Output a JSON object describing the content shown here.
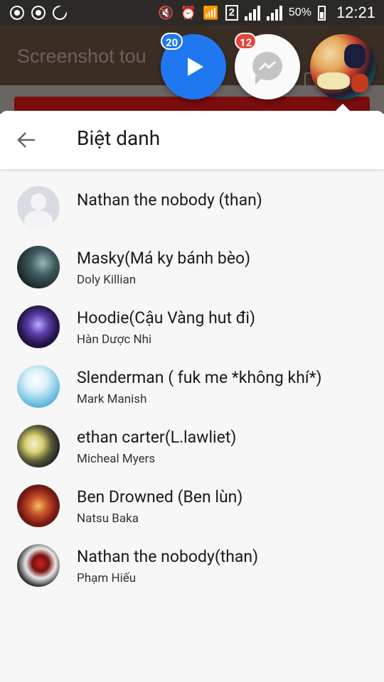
{
  "status_bar": {
    "sim_slot": "2",
    "battery": "50%",
    "time": "12:21"
  },
  "background_app": {
    "title": "Screenshot tou"
  },
  "chat_heads": {
    "play_badge": "20",
    "messenger_badge": "12"
  },
  "panel": {
    "title": "Biệt danh",
    "members": [
      {
        "nickname": "Nathan the nobody (than)",
        "name": ""
      },
      {
        "nickname": "Masky(Má ky bánh bèo)",
        "name": "Doly Killian"
      },
      {
        "nickname": "Hoodie(Cậu Vàng hut đi)",
        "name": "Hàn Dược Nhi"
      },
      {
        "nickname": "Slenderman ( fuk me *không khí*)",
        "name": "Mark Manish"
      },
      {
        "nickname": "ethan carter(L.lawliet)",
        "name": "Micheal Myers"
      },
      {
        "nickname": "Ben Drowned (Ben lùn)",
        "name": "Natsu Baka"
      },
      {
        "nickname": "Nathan the nobody(than)",
        "name": "Phạm Hiếu"
      }
    ]
  }
}
